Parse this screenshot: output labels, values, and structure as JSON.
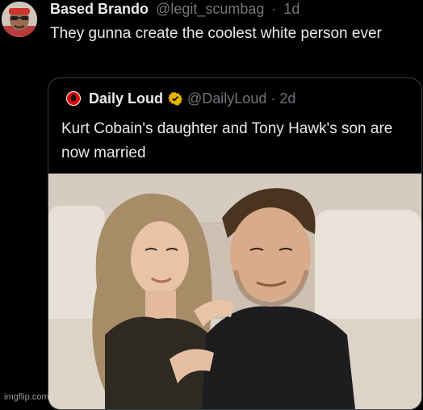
{
  "tweet": {
    "author_name": "Based Brando",
    "author_handle": "@legit_scumbag",
    "separator": "·",
    "time": "1d",
    "text": "They gunna create the coolest white person ever"
  },
  "quoted_tweet": {
    "author_name": "Daily Loud",
    "author_handle": "@DailyLoud",
    "separator": "·",
    "time": "2d",
    "text": "Kurt Cobain's daughter and Tony Hawk's son are now married"
  },
  "watermark": "imgflip.com",
  "colors": {
    "background": "#000000",
    "text_primary": "#e7e9ea",
    "text_secondary": "#71767b",
    "verified_badge": "#e8b400",
    "logo_red": "#e10600"
  }
}
